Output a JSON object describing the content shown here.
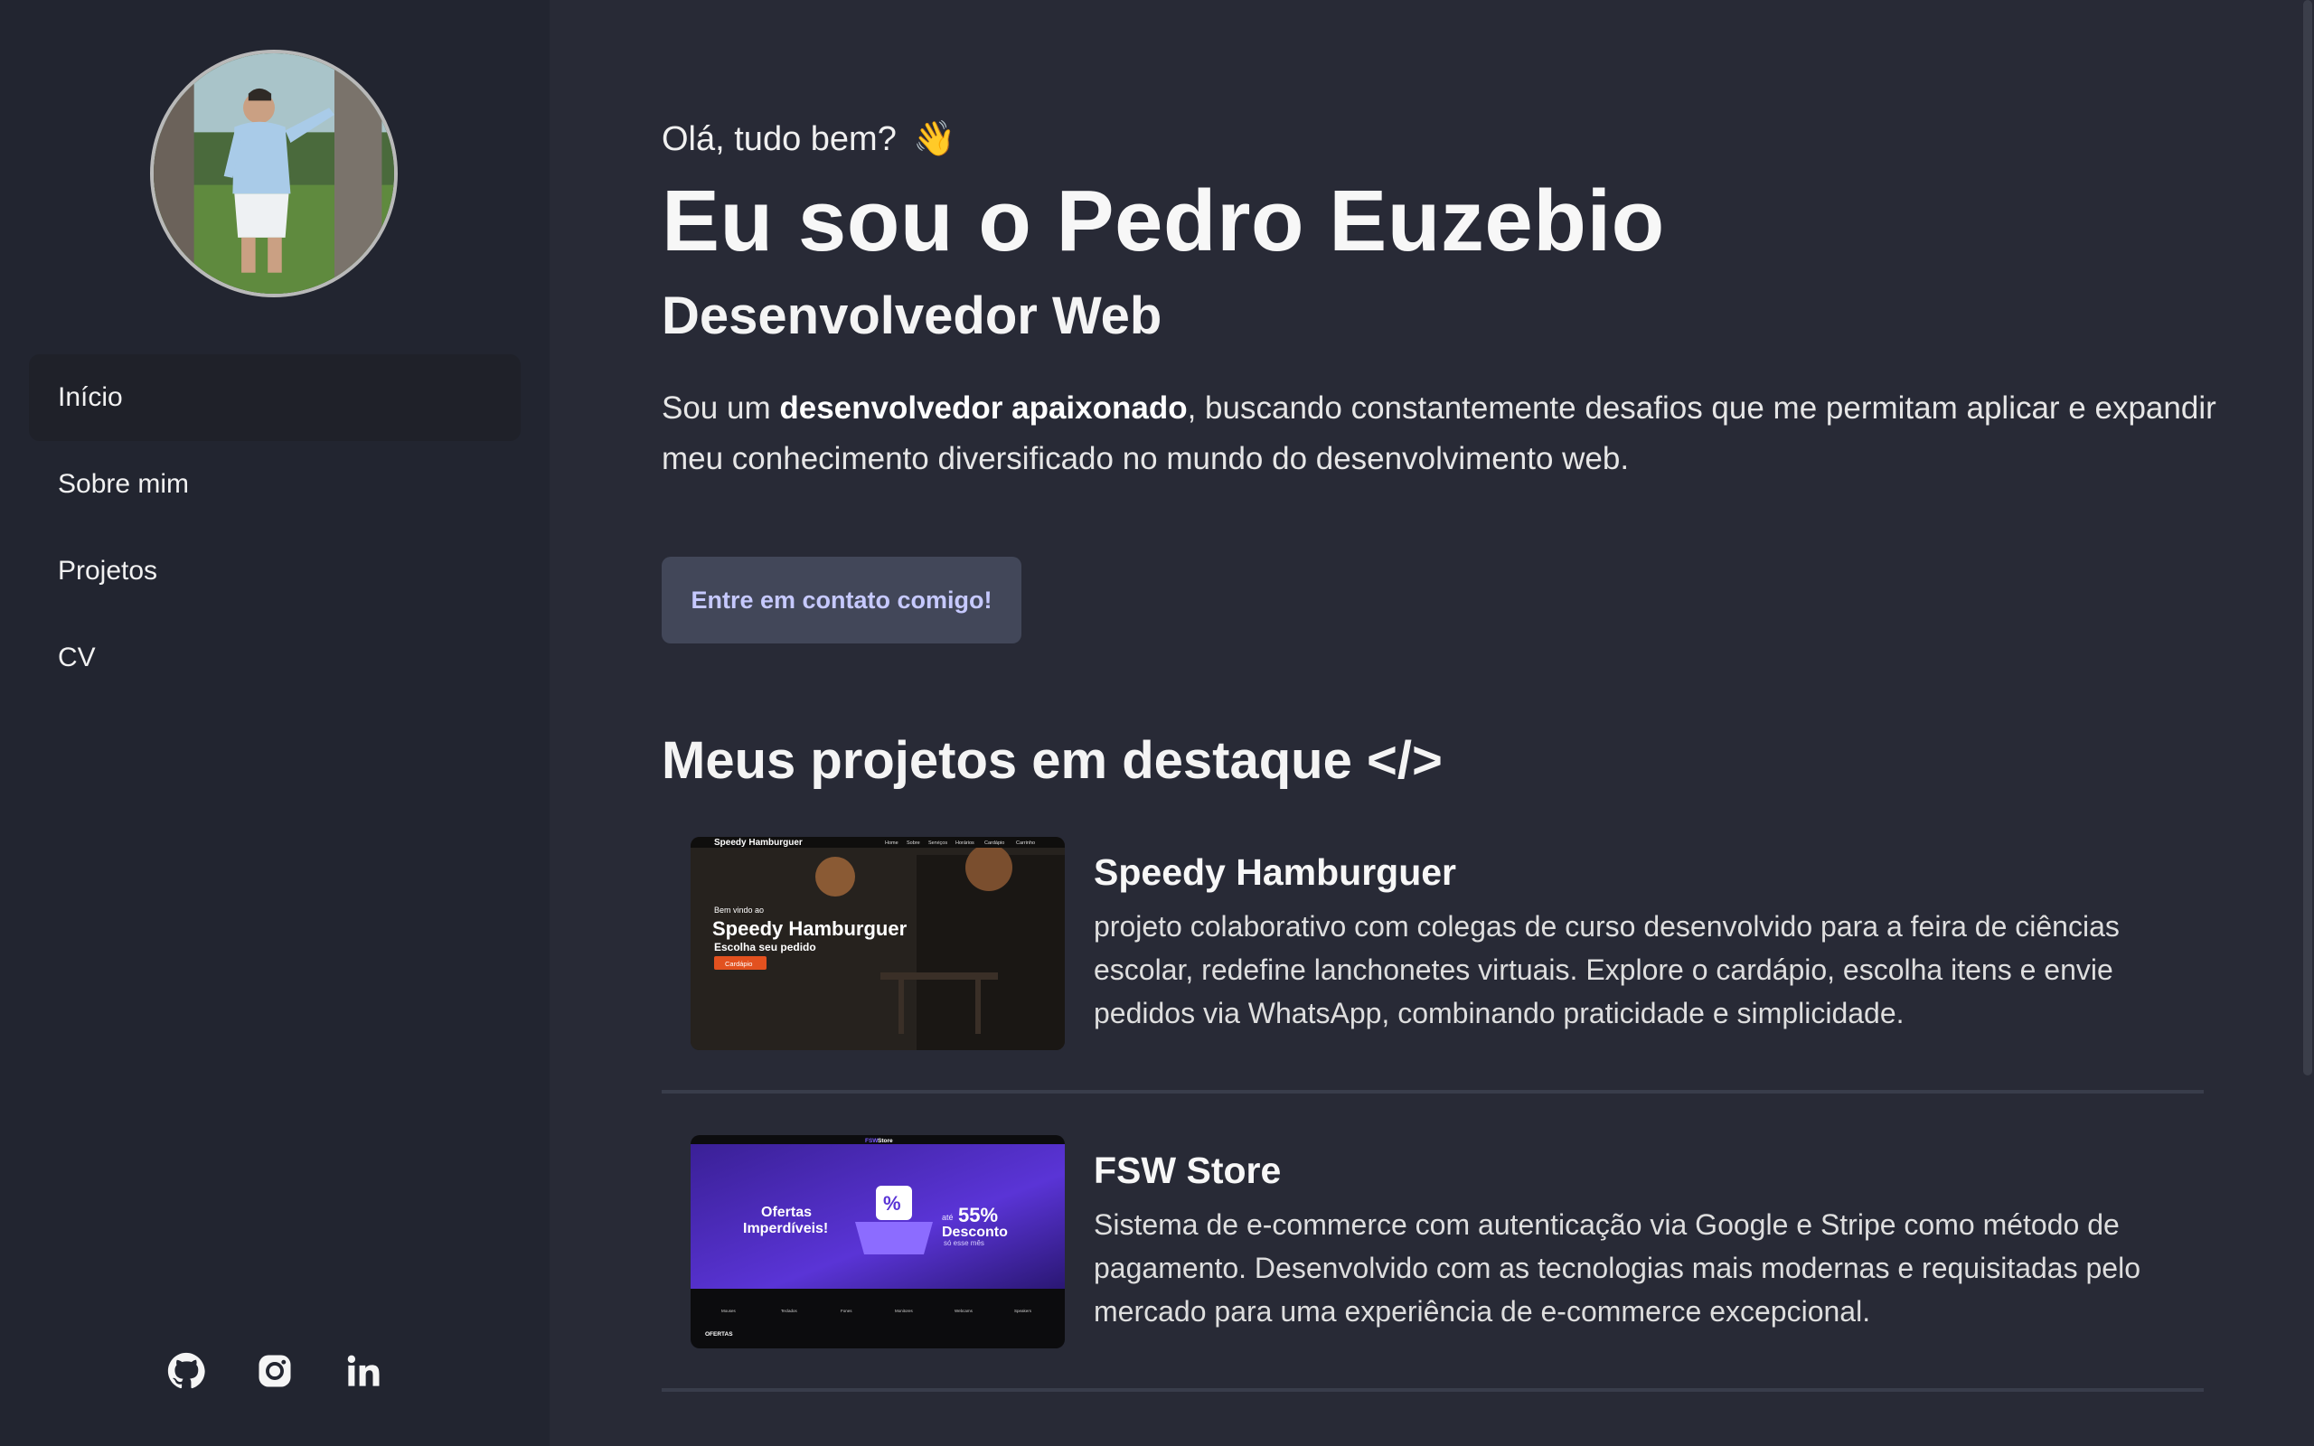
{
  "sidebar": {
    "avatar_alt": "Pedro Euzebio",
    "nav": [
      {
        "label": "Início",
        "active": true
      },
      {
        "label": "Sobre mim",
        "active": false
      },
      {
        "label": "Projetos",
        "active": false
      },
      {
        "label": "CV",
        "active": false
      }
    ],
    "socials": [
      "github-icon",
      "instagram-icon",
      "linkedin-icon"
    ]
  },
  "hero": {
    "greeting": "Olá, tudo bem?",
    "wave_emoji": "👋",
    "name": "Eu sou o Pedro Euzebio",
    "role": "Desenvolvedor Web",
    "intro_prefix": "Sou um ",
    "intro_bold": "desenvolvedor apaixonado",
    "intro_suffix": ", buscando constantemente desafios que me permitam aplicar e expandir meu conhecimento diversificado no mundo do desenvolvimento web.",
    "cta_label": "Entre em contato comigo!"
  },
  "projects_section": {
    "title": "Meus projetos em destaque </>",
    "items": [
      {
        "title": "Speedy Hamburguer",
        "description": "projeto colaborativo com colegas de curso desenvolvido para a feira de ciências escolar, redefine lanchonetes virtuais. Explore o cardápio, escolha itens e envie pedidos via WhatsApp, combinando praticidade e simplicidade.",
        "thumb": {
          "brand": "Speedy Hamburguer",
          "nav": [
            "Home",
            "Sobre",
            "Serviços",
            "Horários",
            "Cardápio",
            "Carrinho"
          ],
          "welcome": "Bem vindo ao",
          "headline": "Speedy Hamburguer",
          "subline": "Escolha seu pedido",
          "button": "Cardápio"
        }
      },
      {
        "title": "FSW Store",
        "description": "Sistema de e-commerce com autenticação via Google e Stripe como método de pagamento. Desenvolvido com as tecnologias mais modernas e requisitadas pelo mercado para uma experiência de e-commerce excepcional.",
        "thumb": {
          "brand_a": "FSW",
          "brand_b": "Store",
          "offer_1": "Ofertas",
          "offer_2": "Imperdíveis!",
          "percent_prefix": "até",
          "percent": "55%",
          "discount": "Desconto",
          "period": "só esse mês",
          "categories": [
            "Mouses",
            "Teclados",
            "Fones",
            "Monitores",
            "Webcams",
            "Speakers"
          ],
          "section": "OFERTAS"
        }
      }
    ]
  },
  "colors": {
    "background": "#282a36",
    "sidebar": "#222530",
    "button_bg": "#424759",
    "button_text": "#c6c9ff"
  }
}
